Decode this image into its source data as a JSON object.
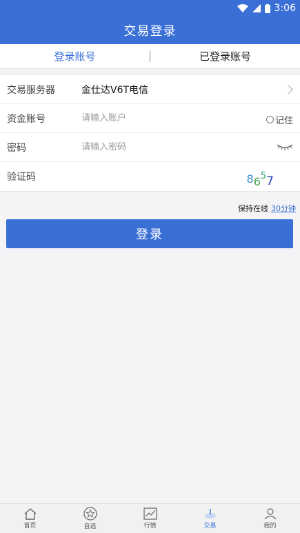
{
  "status": {
    "time": "3:06",
    "icons": [
      "wifi-icon",
      "signal-icon",
      "battery-icon"
    ]
  },
  "header": {
    "title": "交易登录"
  },
  "tabs": [
    {
      "label": "登录账号",
      "active": true
    },
    {
      "label": "已登录账号",
      "active": false
    }
  ],
  "form": {
    "server": {
      "label": "交易服务器",
      "value": "金仕达V6T电信"
    },
    "account": {
      "label": "资金账号",
      "placeholder": "请输入账户",
      "remember_label": "记住"
    },
    "password": {
      "label": "密码",
      "placeholder": "请输入密码"
    },
    "captcha": {
      "label": "验证码",
      "chars": [
        "8",
        "6",
        "5",
        "7"
      ]
    }
  },
  "online": {
    "label": "保持在线",
    "value": "30分钟"
  },
  "login_button": {
    "label": "登录"
  },
  "nav": [
    {
      "label": "首页",
      "icon": "home-icon",
      "active": false
    },
    {
      "label": "自选",
      "icon": "star-icon",
      "active": false
    },
    {
      "label": "行情",
      "icon": "chart-icon",
      "active": false
    },
    {
      "label": "交易",
      "icon": "trade-icon",
      "active": true
    },
    {
      "label": "我的",
      "icon": "user-icon",
      "active": false
    }
  ],
  "colors": {
    "brand": "#3a6fd6",
    "background": "#f4f4f6"
  }
}
